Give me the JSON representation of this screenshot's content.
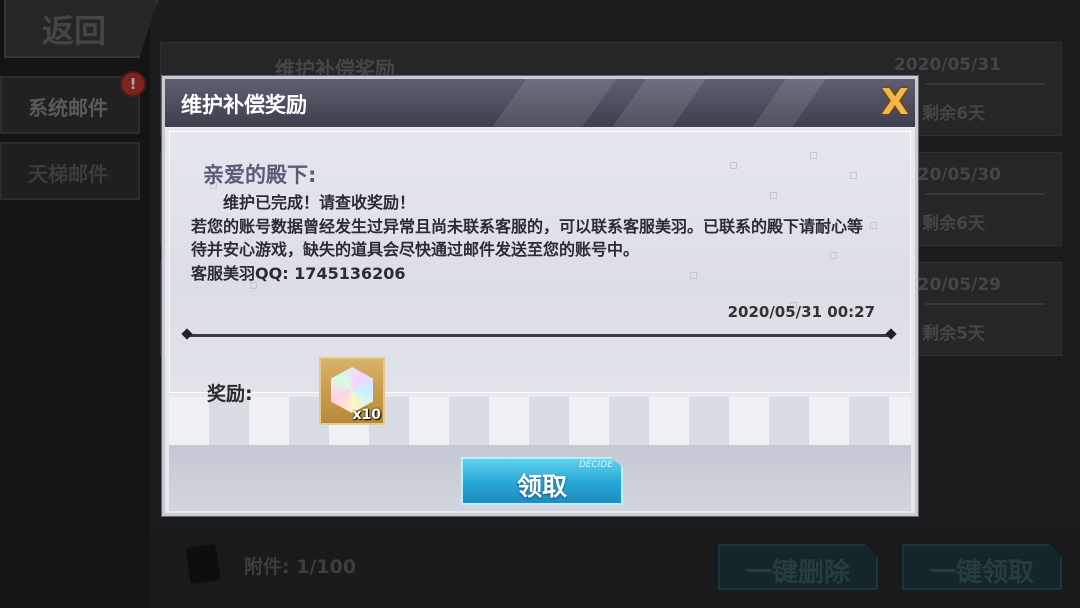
{
  "background": {
    "back_label": "返回",
    "tabs": [
      {
        "label": "系统邮件",
        "badge": "!"
      },
      {
        "label": "天梯邮件"
      }
    ],
    "mails": [
      {
        "title": "维护补偿奖励",
        "date": "2020/05/31",
        "remaining": "剩余6天"
      },
      {
        "title": "",
        "date": "020/05/30",
        "remaining": "剩余6天"
      },
      {
        "title": "",
        "date": "020/05/29",
        "remaining": "剩余5天"
      }
    ],
    "attachments": "附件: 1/100",
    "delete_all": "一键删除",
    "claim_all": "一键领取"
  },
  "dialog": {
    "title": "维护补偿奖励",
    "close_icon": "X",
    "greeting": "亲爱的殿下:",
    "message_lines": [
      "维护已完成！请查收奖励！",
      "若您的账号数据曾经发生过异常且尚未联系客服的，可以联系客服美羽。已联系的殿下请耐心等待并安心游戏，缺失的道具会尽快通过邮件发送至您的账号中。",
      "客服美羽QQ: 1745136206"
    ],
    "timestamp": "2020/05/31 00:27",
    "reward_label": "奖励:",
    "reward_item": {
      "icon": "rainbow-crystal-icon",
      "quantity": "x10"
    },
    "claim_button": "领取",
    "claim_tag": "DECIDE"
  }
}
